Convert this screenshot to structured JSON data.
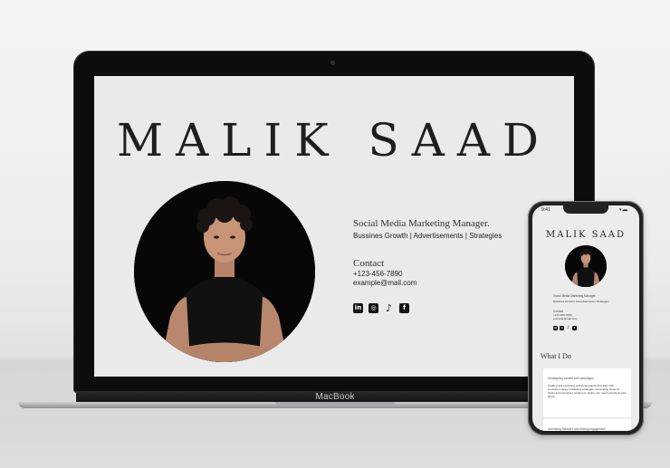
{
  "site": {
    "name": "MALIK SAAD",
    "role": "Social Media Marketing Manager.",
    "tags": "Bussines Growth | Advertisements | Strategies",
    "contact_heading": "Contact",
    "phone": "+123-456-7890",
    "email": "example@mail.com",
    "socials": [
      {
        "name": "linkedin",
        "glyph": "in"
      },
      {
        "name": "instagram",
        "glyph": "◎"
      },
      {
        "name": "tiktok",
        "glyph": "♪"
      },
      {
        "name": "facebook",
        "glyph": "f"
      }
    ]
  },
  "laptop": {
    "brand": "MacBook"
  },
  "phone": {
    "status_time": "9:41",
    "status_icons": "▾ ▬",
    "what_heading": "What I Do",
    "cards": [
      {
        "title": "Strategizing content and campaigns",
        "body": "ideating and executing social campaigns that align with company's larger marketing strategies. Generating ideas for timely and evergreen content on topics your users genuinely care about"
      },
      {
        "title": "Increasing followers and driving engagement",
        "body": ""
      }
    ]
  },
  "colors": {
    "screen_bg": "#eaeaea",
    "text": "#1e1e1e",
    "photo_bg": "#070707"
  }
}
